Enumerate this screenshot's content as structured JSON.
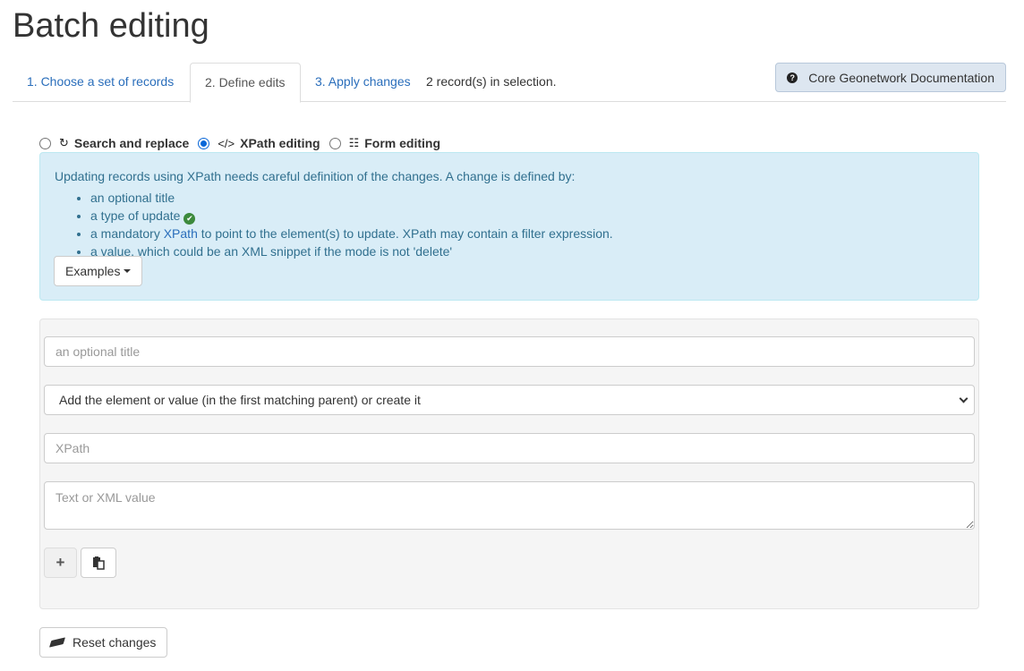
{
  "page": {
    "title": "Batch editing"
  },
  "tabs": [
    {
      "label": "1. Choose a set of records"
    },
    {
      "label": "2. Define edits"
    },
    {
      "label": "3. Apply changes"
    }
  ],
  "selection_count": "2 record(s) in selection.",
  "doc_button": {
    "label": "Core Geonetwork Documentation",
    "icon": "question-circle-icon"
  },
  "modes": [
    {
      "label": "Search and replace",
      "icon": "refresh-icon",
      "checked": false
    },
    {
      "label": "XPath editing",
      "icon": "code-icon",
      "checked": true
    },
    {
      "label": "Form editing",
      "icon": "list-alt-icon",
      "checked": false
    }
  ],
  "info": {
    "intro": "Updating records using XPath needs careful definition of the changes. A change is defined by:",
    "items": [
      {
        "text": "an optional title"
      },
      {
        "text": "a type of update",
        "icon": "check-circle-icon"
      },
      {
        "prefix": "a mandatory ",
        "link": "XPath",
        "suffix": " to point to the element(s) to update. XPath may contain a filter expression."
      },
      {
        "text": "a value, which could be an XML snippet if the mode is not 'delete'"
      }
    ],
    "examples_label": "Examples"
  },
  "edit_form": {
    "title_placeholder": "an optional title",
    "update_type_selected": "Add the element or value (in the first matching parent) or create it",
    "xpath_placeholder": "XPath",
    "value_placeholder": "Text or XML value"
  },
  "reset_label": "Reset changes",
  "colors": {
    "link": "#2a6ebb",
    "info_background": "#d9edf7",
    "info_text": "#31708f",
    "radio_checked": "#0b68d8",
    "doc_button_background": "#dde6f0"
  }
}
